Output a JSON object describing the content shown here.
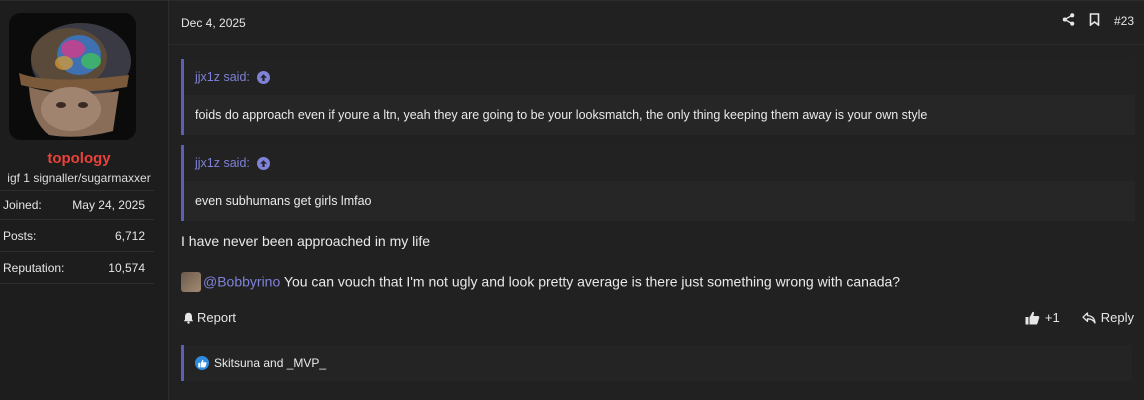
{
  "user": {
    "username": "topology",
    "title": "igf 1 signaller/sugarmaxxer",
    "stats": [
      {
        "label": "Joined:",
        "value": "May 24, 2025"
      },
      {
        "label": "Posts:",
        "value": "6,712"
      },
      {
        "label": "Reputation:",
        "value": "10,574"
      }
    ],
    "avatar_icon": "brain-scan-avatar"
  },
  "post": {
    "date": "Dec 4, 2025",
    "number": "#23",
    "quotes": [
      {
        "author": "jjx1z said:",
        "body": "foids do approach even if youre a ltn, yeah they are going to be your looksmatch, the only thing keeping them away is your own style"
      },
      {
        "author": "jjx1z said:",
        "body": "even subhumans get girls lmfao"
      }
    ],
    "message_line1": "I have never been approached in my life",
    "mention": "@Bobbyrino",
    "message_line2": "You can vouch that I'm not ugly and look pretty average is there just something wrong with canada?"
  },
  "actions": {
    "report": "Report",
    "like_count": "+1",
    "reply": "Reply"
  },
  "reactions": {
    "text": "Skitsuna and _MVP_"
  },
  "colors": {
    "accent": "#7e82d8",
    "username": "#e9423a",
    "quote_border": "#5b5fb8",
    "like": "#2f8be0"
  }
}
